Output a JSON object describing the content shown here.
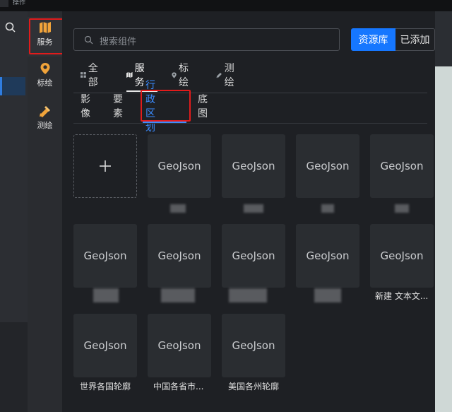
{
  "topbar": {
    "title": "操作"
  },
  "nav": {
    "items": [
      {
        "label": "服务",
        "icon": "map-icon"
      },
      {
        "label": "标绘",
        "icon": "location-pin-icon"
      },
      {
        "label": "测绘",
        "icon": "ruler-pencil-icon"
      }
    ]
  },
  "search": {
    "placeholder": "搜索组件"
  },
  "segment": {
    "library": "资源库",
    "added": "已添加"
  },
  "tabs": [
    {
      "label": "全部",
      "icon": "grid-icon"
    },
    {
      "label": "服务",
      "icon": "map-icon"
    },
    {
      "label": "标绘",
      "icon": "location-pin-icon"
    },
    {
      "label": "测绘",
      "icon": "ruler-pencil-icon"
    }
  ],
  "subtabs": [
    "影像",
    "要素",
    "行政区划",
    "底图"
  ],
  "cards": [
    {
      "title": "GeoJson",
      "caption": ""
    },
    {
      "title": "GeoJson",
      "caption": ""
    },
    {
      "title": "GeoJson",
      "caption": ""
    },
    {
      "title": "GeoJson",
      "caption": ""
    },
    {
      "title": "GeoJson",
      "caption": ""
    },
    {
      "title": "GeoJson",
      "caption": ""
    },
    {
      "title": "GeoJson",
      "caption": ""
    },
    {
      "title": "GeoJson",
      "caption": ""
    },
    {
      "title": "GeoJson",
      "caption": "新建 文本文..."
    },
    {
      "title": "GeoJson",
      "caption": "世界各国轮廓"
    },
    {
      "title": "GeoJson",
      "caption": "中国各省市..."
    },
    {
      "title": "GeoJson",
      "caption": "美国各州轮廓"
    }
  ],
  "colors": {
    "accent": "#1677ff",
    "highlight": "#e21b1b"
  }
}
